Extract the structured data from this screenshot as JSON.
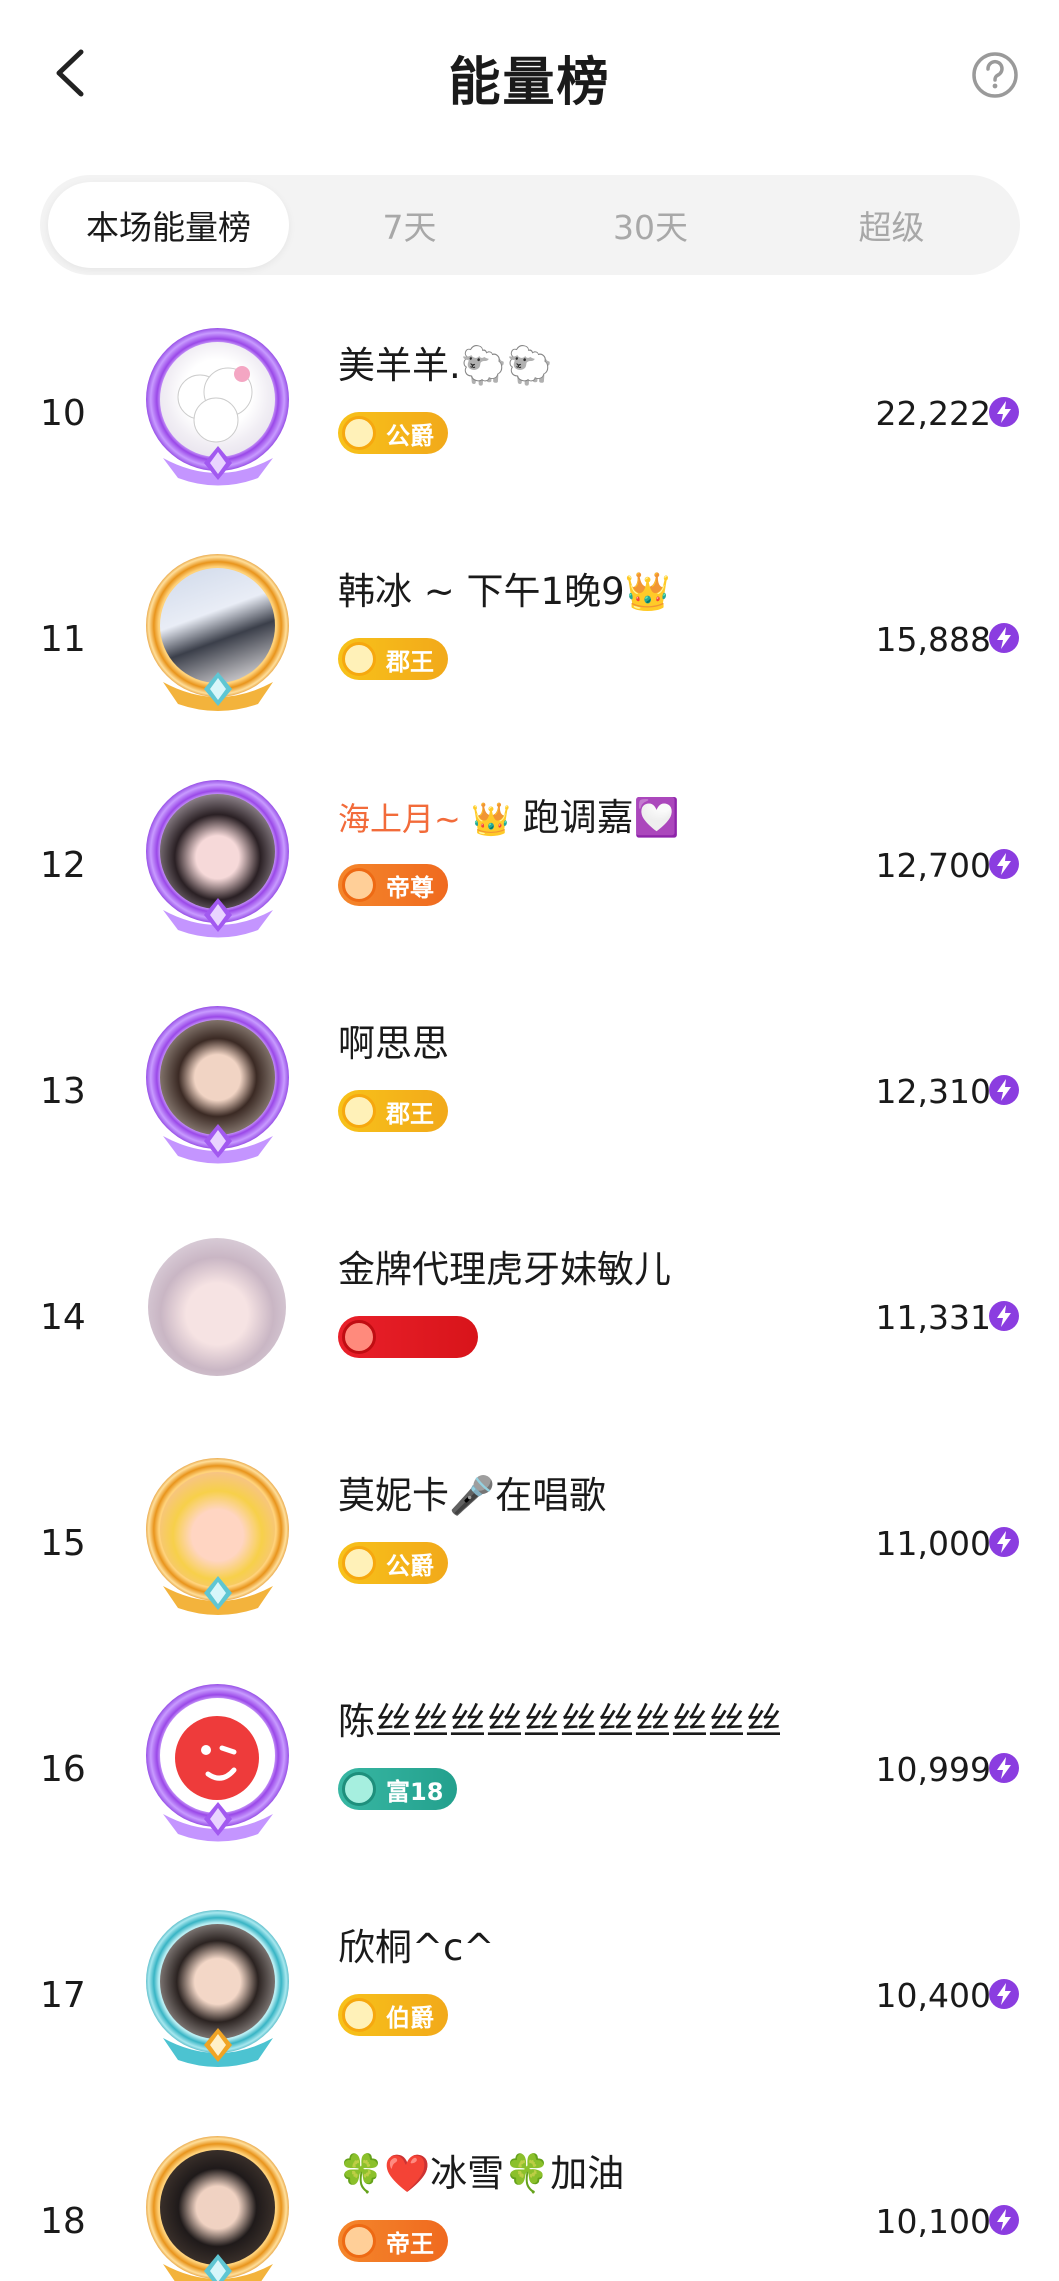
{
  "header": {
    "title": "能量榜"
  },
  "tabs": [
    {
      "label": "本场能量榜",
      "active": true
    },
    {
      "label": "7天",
      "active": false
    },
    {
      "label": "30天",
      "active": false
    },
    {
      "label": "超级",
      "active": false
    }
  ],
  "rows": [
    {
      "rank": "10",
      "name": "美羊羊.🐑🐑",
      "badge": "公爵",
      "badge_style": "gold",
      "score": "22,222",
      "frame": "purple"
    },
    {
      "rank": "11",
      "name": "韩冰 ~ 下午1晚9👑",
      "badge": "郡王",
      "badge_style": "gold",
      "score": "15,888",
      "frame": "gold"
    },
    {
      "rank": "12",
      "name_prefix": "海上月~ 👑",
      "name": " 跑调嘉💟",
      "badge": "帝尊",
      "badge_style": "orange",
      "score": "12,700",
      "frame": "purple"
    },
    {
      "rank": "13",
      "name": "啊思思",
      "badge": "郡王",
      "badge_style": "gold",
      "score": "12,310",
      "frame": "purple"
    },
    {
      "rank": "14",
      "name": "金牌代理虎牙妹敏儿",
      "badge": "",
      "badge_style": "red",
      "score": "11,331",
      "frame": "none"
    },
    {
      "rank": "15",
      "name": "莫妮卡🎤在唱歌",
      "badge": "公爵",
      "badge_style": "gold",
      "score": "11,000",
      "frame": "gold"
    },
    {
      "rank": "16",
      "name": "陈丝丝丝丝丝丝丝丝丝丝丝",
      "badge": "富18",
      "badge_style": "teal",
      "score": "10,999",
      "frame": "purple"
    },
    {
      "rank": "17",
      "name": "欣桐^c^",
      "badge": "伯爵",
      "badge_style": "gold",
      "score": "10,400",
      "frame": "teal"
    },
    {
      "rank": "18",
      "name": "🍀❤️冰雪🍀加油",
      "badge": "帝王",
      "badge_style": "orange",
      "score": "10,100",
      "frame": "gold"
    }
  ],
  "colors": {
    "accent_purple": "#8b3de0",
    "frame_gold": "#f0a424",
    "frame_teal": "#4cc3d1",
    "tab_bg": "#f3f3f3",
    "muted_text": "#a8a8a8"
  },
  "icons": {
    "back": "chevron-left-icon",
    "help": "question-circle-icon",
    "score": "lightning-bolt-icon"
  }
}
